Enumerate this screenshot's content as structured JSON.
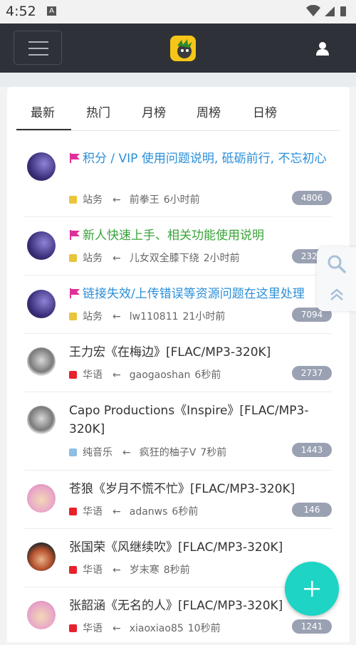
{
  "status_bar": {
    "time": "4:52",
    "notif": "A"
  },
  "tabs": [
    "最新",
    "热门",
    "月榜",
    "周榜",
    "日榜"
  ],
  "threads": [
    {
      "title": "积分 / VIP 使用问题说明, 砥砺前行, 不忘初心",
      "pinned": true,
      "color": "blue",
      "category": "站务",
      "cat_color": "#e8c53a",
      "author": "前拳王",
      "time": "6小时前",
      "count": "4806"
    },
    {
      "title": "新人快速上手、相关功能使用说明",
      "pinned": true,
      "color": "green",
      "category": "站务",
      "cat_color": "#e8c53a",
      "author": "儿女双全膝下绕",
      "time": "2小时前",
      "count": "2323"
    },
    {
      "title": "链接失效/上传错误等资源问题在这里处理",
      "pinned": true,
      "color": "blue",
      "category": "站务",
      "cat_color": "#e8c53a",
      "author": "lw110811",
      "time": "21小时前",
      "count": "7094"
    },
    {
      "title": "王力宏《在梅边》[FLAC/MP3-320K]",
      "pinned": false,
      "color": "normal",
      "category": "华语",
      "cat_color": "#e8212d",
      "author": "gaogaoshan",
      "time": "6秒前",
      "count": "2737"
    },
    {
      "title": "Capo Productions《Inspire》[FLAC/MP3-320K]",
      "pinned": false,
      "color": "normal",
      "category": "纯音乐",
      "cat_color": "#8ebde6",
      "author": "疯狂的柚子V",
      "time": "7秒前",
      "count": "1443"
    },
    {
      "title": "苍狼《岁月不慌不忙》[FLAC/MP3-320K]",
      "pinned": false,
      "color": "normal",
      "category": "华语",
      "cat_color": "#e8212d",
      "author": "adanws",
      "time": "6秒前",
      "count": "146"
    },
    {
      "title": "张国荣《风继续吹》[FLAC/MP3-320K]",
      "pinned": false,
      "color": "normal",
      "category": "华语",
      "cat_color": "#e8212d",
      "author": "岁末寒",
      "time": "8秒前",
      "count": ""
    },
    {
      "title": "张韶涵《无名的人》[FLAC/MP3-320K]",
      "pinned": false,
      "color": "normal",
      "category": "华语",
      "cat_color": "#e8212d",
      "author": "xiaoxiao85",
      "time": "10秒前",
      "count": "1241"
    }
  ],
  "colors": {
    "nav_bg": "#2e3238",
    "pin_flag": "#e0309a",
    "badge": "#99a1b2",
    "fab": "#1ed4c4",
    "link_blue": "#2a8fd9",
    "link_green": "#3aa33a"
  },
  "icons": {
    "menu": "hamburger-menu-icon",
    "user": "user-icon",
    "search": "search-icon",
    "top": "scroll-to-top-icon",
    "add": "plus-icon",
    "flag": "flag-icon"
  }
}
